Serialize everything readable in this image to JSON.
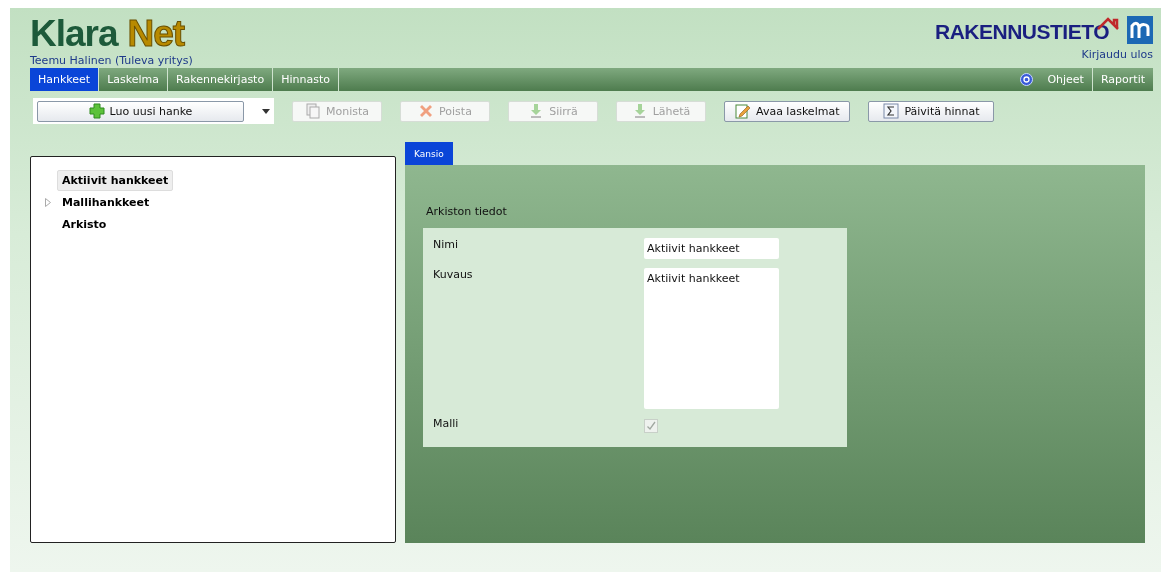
{
  "logo": {
    "part1": "Klara",
    "part2": "Net"
  },
  "user": "Teemu Halinen (Tuleva yritys)",
  "brand": "RAKENNUSTIETO",
  "logout": "Kirjaudu ulos",
  "nav": [
    {
      "label": "Hankkeet",
      "selected": true
    },
    {
      "label": "Laskelma",
      "selected": false
    },
    {
      "label": "Rakennekirjasto",
      "selected": false
    },
    {
      "label": "Hinnasto",
      "selected": false
    }
  ],
  "nav_right": [
    "Ohjeet",
    "Raportit"
  ],
  "toolbar": [
    {
      "label": "Luo uusi hanke",
      "disabled": false,
      "kind": "split"
    },
    {
      "label": "Monista",
      "disabled": true,
      "kind": "button"
    },
    {
      "label": "Poista",
      "disabled": true,
      "kind": "button"
    },
    {
      "label": "Siirrä",
      "disabled": true,
      "kind": "button"
    },
    {
      "label": "Lähetä",
      "disabled": true,
      "kind": "button"
    },
    {
      "label": "Avaa laskelmat",
      "disabled": false,
      "kind": "button"
    },
    {
      "label": "Päivitä hinnat",
      "disabled": false,
      "kind": "button"
    }
  ],
  "tree": [
    {
      "label": "Aktiivit hankkeet",
      "selected": true,
      "expandable": false
    },
    {
      "label": "Mallihankkeet",
      "selected": false,
      "expandable": true
    },
    {
      "label": "Arkisto",
      "selected": false,
      "expandable": false
    }
  ],
  "tabs": [
    {
      "label": "Kansio",
      "selected": true
    }
  ],
  "section_title": "Arkiston tiedot",
  "form": {
    "name_label": "Nimi",
    "name_value": "Aktiivit hankkeet",
    "desc_label": "Kuvaus",
    "desc_value": "Aktiivit hankkeet",
    "model_label": "Malli",
    "model_checked": true
  }
}
